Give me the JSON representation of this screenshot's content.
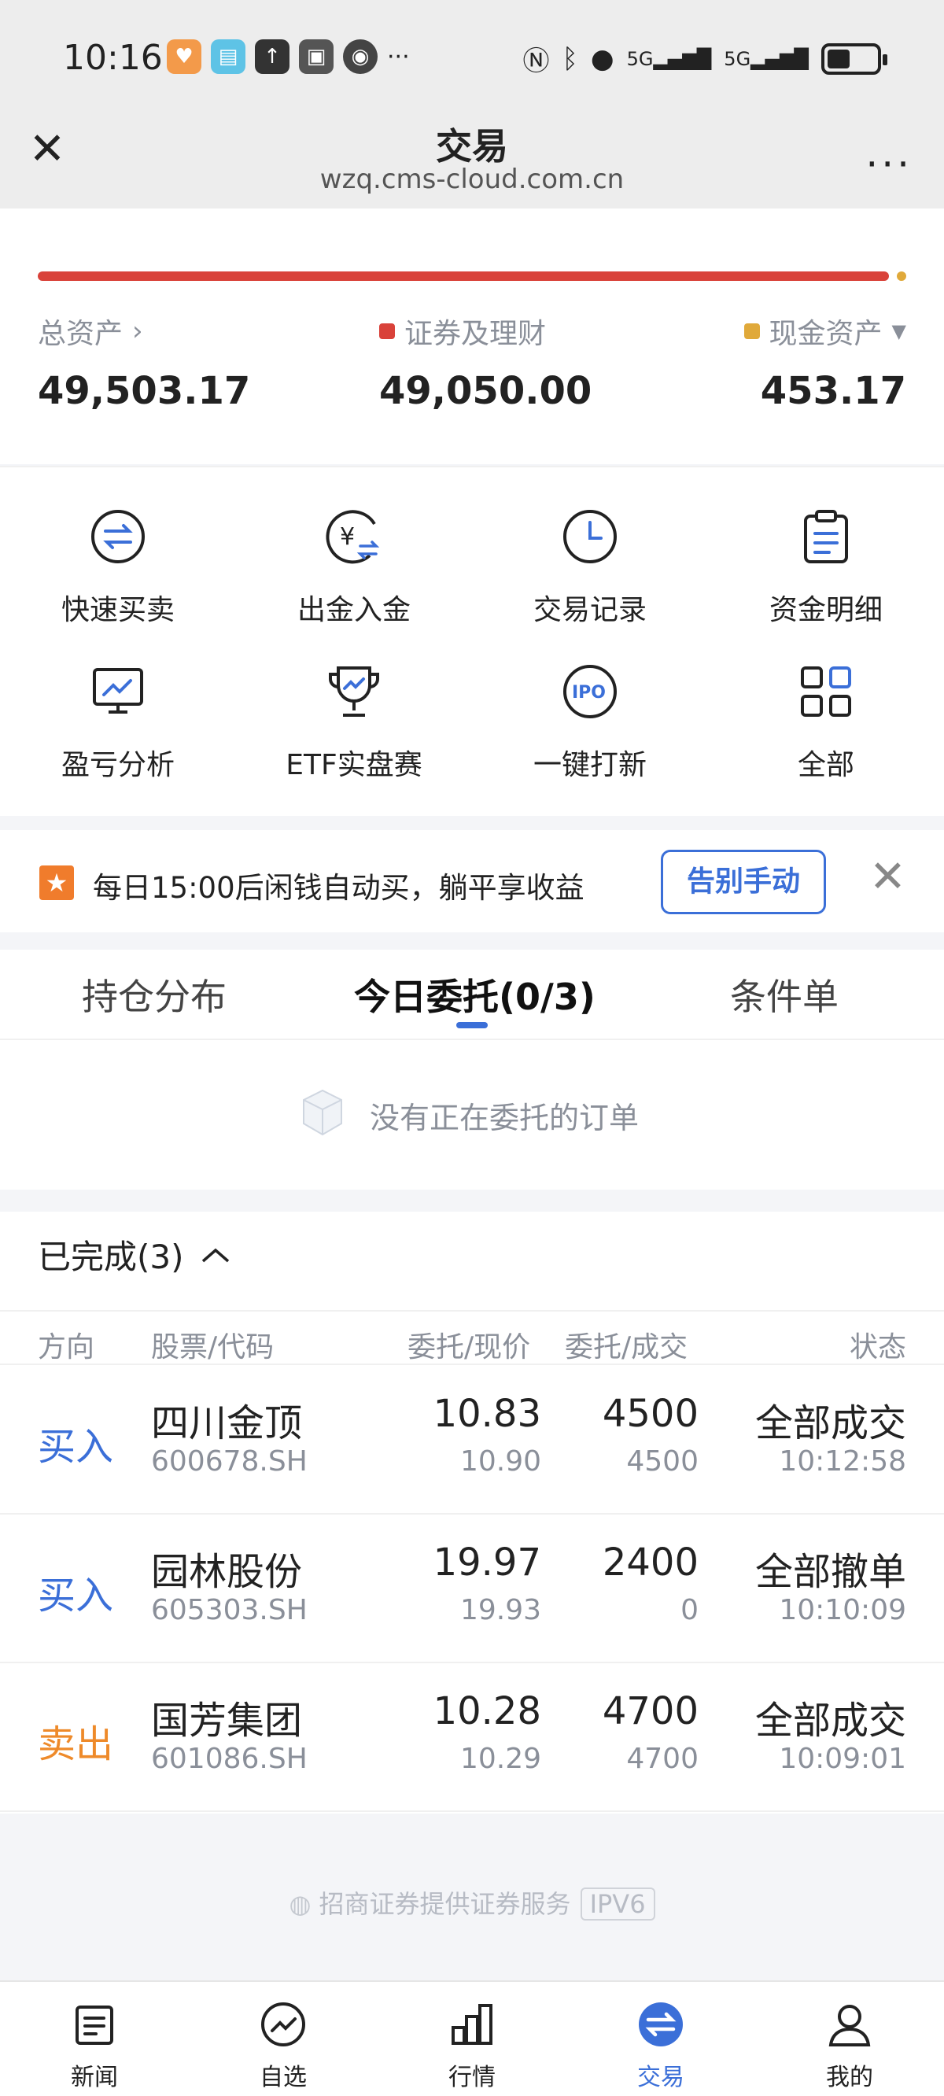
{
  "status_bar": {
    "time": "10:16",
    "network_1": "5G",
    "network_2": "5G",
    "more": "···"
  },
  "header": {
    "title": "交易",
    "subtitle": "wzq.cms-cloud.com.cn",
    "more": "···"
  },
  "asset": {
    "total_label": "总资产",
    "total_value": "49,503.17",
    "securities_label": "证券及理财",
    "securities_value": "49,050.00",
    "cash_label": "现金资产",
    "cash_value": "453.17",
    "securities_color": "#d9423a",
    "cash_color": "#e0a93a"
  },
  "functions": [
    {
      "label": "快速买卖",
      "icon": "swap-icon"
    },
    {
      "label": "出金入金",
      "icon": "yen-transfer-icon"
    },
    {
      "label": "交易记录",
      "icon": "clock-icon"
    },
    {
      "label": "资金明细",
      "icon": "clipboard-icon"
    },
    {
      "label": "盈亏分析",
      "icon": "monitor-chart-icon"
    },
    {
      "label": "ETF实盘赛",
      "icon": "trophy-icon"
    },
    {
      "label": "一键打新",
      "icon": "ipo-icon"
    },
    {
      "label": "全部",
      "icon": "grid-icon"
    }
  ],
  "promo": {
    "text": "每日15:00后闲钱自动买，躺平享收益",
    "button": "告别手动"
  },
  "tabs": [
    {
      "label": "持仓分布",
      "active": false
    },
    {
      "label": "今日委托(0/3)",
      "active": true
    },
    {
      "label": "条件单",
      "active": false
    }
  ],
  "empty_text": "没有正在委托的订单",
  "completed": {
    "title": "已完成(3)",
    "columns": {
      "direction": "方向",
      "stock": "股票/代码",
      "price": "委托/现价",
      "qty": "委托/成交",
      "status": "状态"
    },
    "rows": [
      {
        "direction": "买入",
        "name": "四川金顶",
        "code": "600678.SH",
        "order_price": "10.83",
        "current_price": "10.90",
        "order_qty": "4500",
        "filled_qty": "4500",
        "status": "全部成交",
        "time": "10:12:58",
        "dir_color": "#3b6fd8"
      },
      {
        "direction": "买入",
        "name": "园林股份",
        "code": "605303.SH",
        "order_price": "19.97",
        "current_price": "19.93",
        "order_qty": "2400",
        "filled_qty": "0",
        "status": "全部撤单",
        "time": "10:10:09",
        "dir_color": "#3b6fd8"
      },
      {
        "direction": "卖出",
        "name": "国芳集团",
        "code": "601086.SH",
        "order_price": "10.28",
        "current_price": "10.29",
        "order_qty": "4700",
        "filled_qty": "4700",
        "status": "全部成交",
        "time": "10:09:01",
        "dir_color": "#ee8a2a"
      }
    ]
  },
  "footer": {
    "text": "招商证券提供证券服务",
    "badge": "IPV6"
  },
  "bottom_nav": [
    {
      "label": "新闻",
      "icon": "news-icon",
      "active": false
    },
    {
      "label": "自选",
      "icon": "trend-icon",
      "active": false
    },
    {
      "label": "行情",
      "icon": "bar-chart-icon",
      "active": false
    },
    {
      "label": "交易",
      "icon": "trade-swap-icon",
      "active": true
    },
    {
      "label": "我的",
      "icon": "user-icon",
      "active": false
    }
  ],
  "accent_color": "#3b6fd8"
}
